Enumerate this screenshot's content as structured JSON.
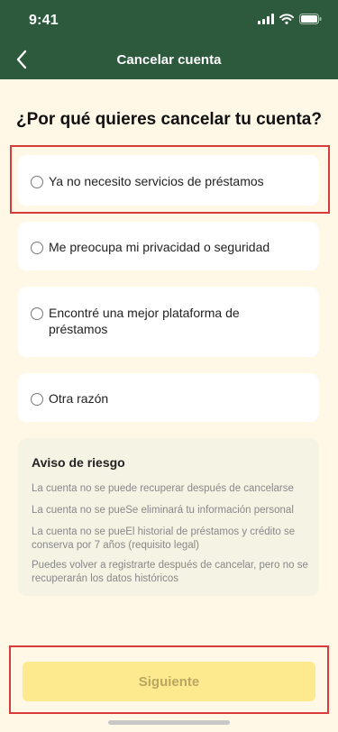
{
  "status_bar": {
    "time": "9:41"
  },
  "header": {
    "title": "Cancelar cuenta"
  },
  "question": "¿Por qué quieres cancelar tu cuenta?",
  "options": [
    {
      "label": "Ya no necesito servicios de préstamos"
    },
    {
      "label": "Me preocupa mi privacidad o seguridad"
    },
    {
      "label": "Encontré una mejor plataforma de préstamos"
    },
    {
      "label": "Otra razón"
    }
  ],
  "risk": {
    "title": "Aviso de riesgo",
    "lines": [
      "La cuenta no se puede recuperar después de cancelarse",
      "La cuenta no se pueSe eliminará tu información personal",
      "La cuenta no se pueEl historial de préstamos y crédito se conserva por 7 años (requisito legal)",
      "Puedes volver a registrarte después de cancelar, pero no se recuperarán los datos históricos"
    ]
  },
  "cta": {
    "label": "Siguiente"
  }
}
